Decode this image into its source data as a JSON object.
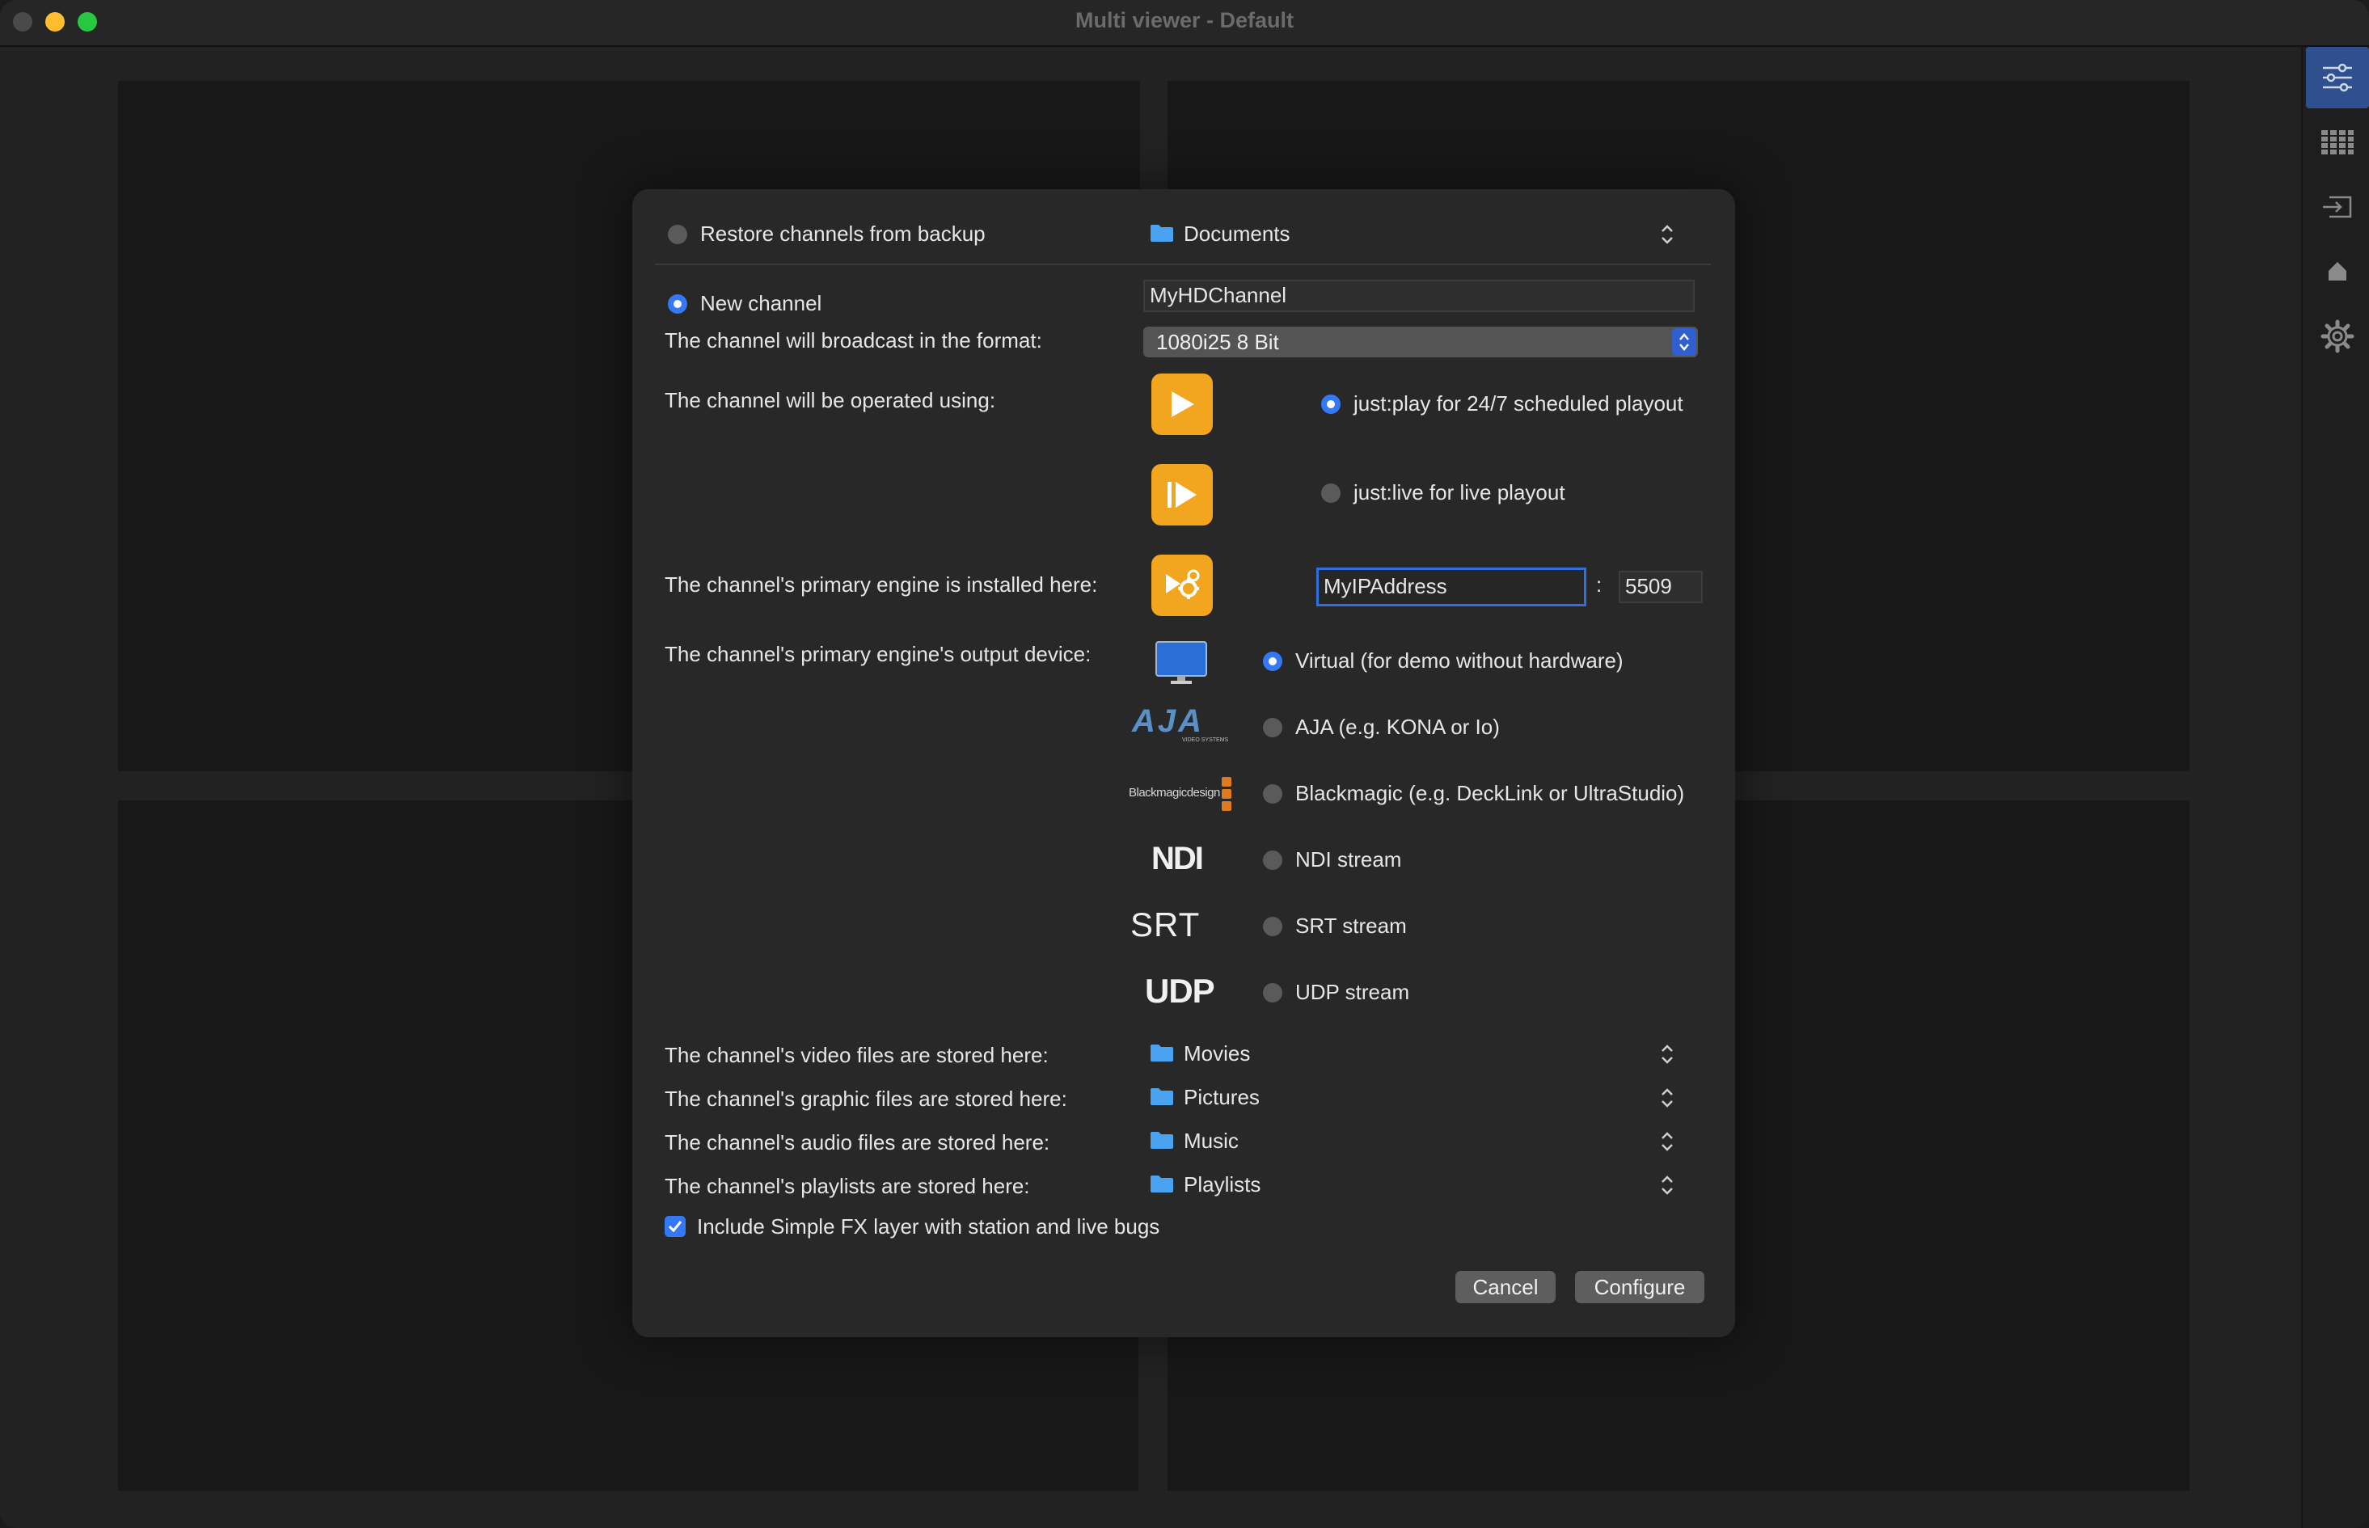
{
  "window": {
    "title": "Multi viewer - Default"
  },
  "sidebar": {
    "items": [
      {
        "icon": "sliders-icon",
        "active": true
      },
      {
        "icon": "grid-icon",
        "active": false
      },
      {
        "icon": "input-icon",
        "active": false
      },
      {
        "icon": "bell-icon",
        "active": false
      },
      {
        "icon": "gear-icon",
        "active": false
      }
    ]
  },
  "dialog": {
    "restore": {
      "label": "Restore channels from backup",
      "selected": false,
      "folder": "Documents"
    },
    "new_channel": {
      "label": "New channel",
      "selected": true,
      "name_value": "MyHDChannel"
    },
    "format": {
      "label": "The channel will broadcast in the format:",
      "value": "1080i25 8 Bit"
    },
    "operated": {
      "label": "The channel will be operated using:",
      "options": [
        {
          "label": "just:play for 24/7 scheduled playout",
          "selected": true,
          "icon": "play-icon"
        },
        {
          "label": "just:live for live playout",
          "selected": false,
          "icon": "live-play-icon"
        }
      ]
    },
    "engine": {
      "label": "The channel's primary engine is installed here:",
      "host": "MyIPAddress",
      "separator": ":",
      "port": "5509"
    },
    "output": {
      "label": "The channel's primary engine's output device:",
      "options": [
        {
          "label": "Virtual (for demo without hardware)",
          "selected": true,
          "logo": "monitor-icon"
        },
        {
          "label": "AJA (e.g. KONA or Io)",
          "selected": false,
          "logo": "AJA",
          "logo_sub": "VIDEO SYSTEMS"
        },
        {
          "label": "Blackmagic (e.g. DeckLink or UltraStudio)",
          "selected": false,
          "logo": "Blackmagicdesign"
        },
        {
          "label": "NDI stream",
          "selected": false,
          "logo": "NDI"
        },
        {
          "label": "SRT stream",
          "selected": false,
          "logo": "SRT"
        },
        {
          "label": "UDP stream",
          "selected": false,
          "logo": "UDP"
        }
      ]
    },
    "storage": [
      {
        "label": "The channel's video files are stored here:",
        "folder": "Movies"
      },
      {
        "label": "The channel's graphic files are stored here:",
        "folder": "Pictures"
      },
      {
        "label": "The channel's audio files are stored here:",
        "folder": "Music"
      },
      {
        "label": "The channel's playlists are stored here:",
        "folder": "Playlists"
      }
    ],
    "simple_fx": {
      "label": "Include Simple FX layer with station and live bugs",
      "checked": true
    },
    "buttons": {
      "cancel": "Cancel",
      "configure": "Configure"
    }
  },
  "colors": {
    "accent": "#3478f6",
    "app_icon": "#f2a51f",
    "folder": "#4aa3f0"
  }
}
